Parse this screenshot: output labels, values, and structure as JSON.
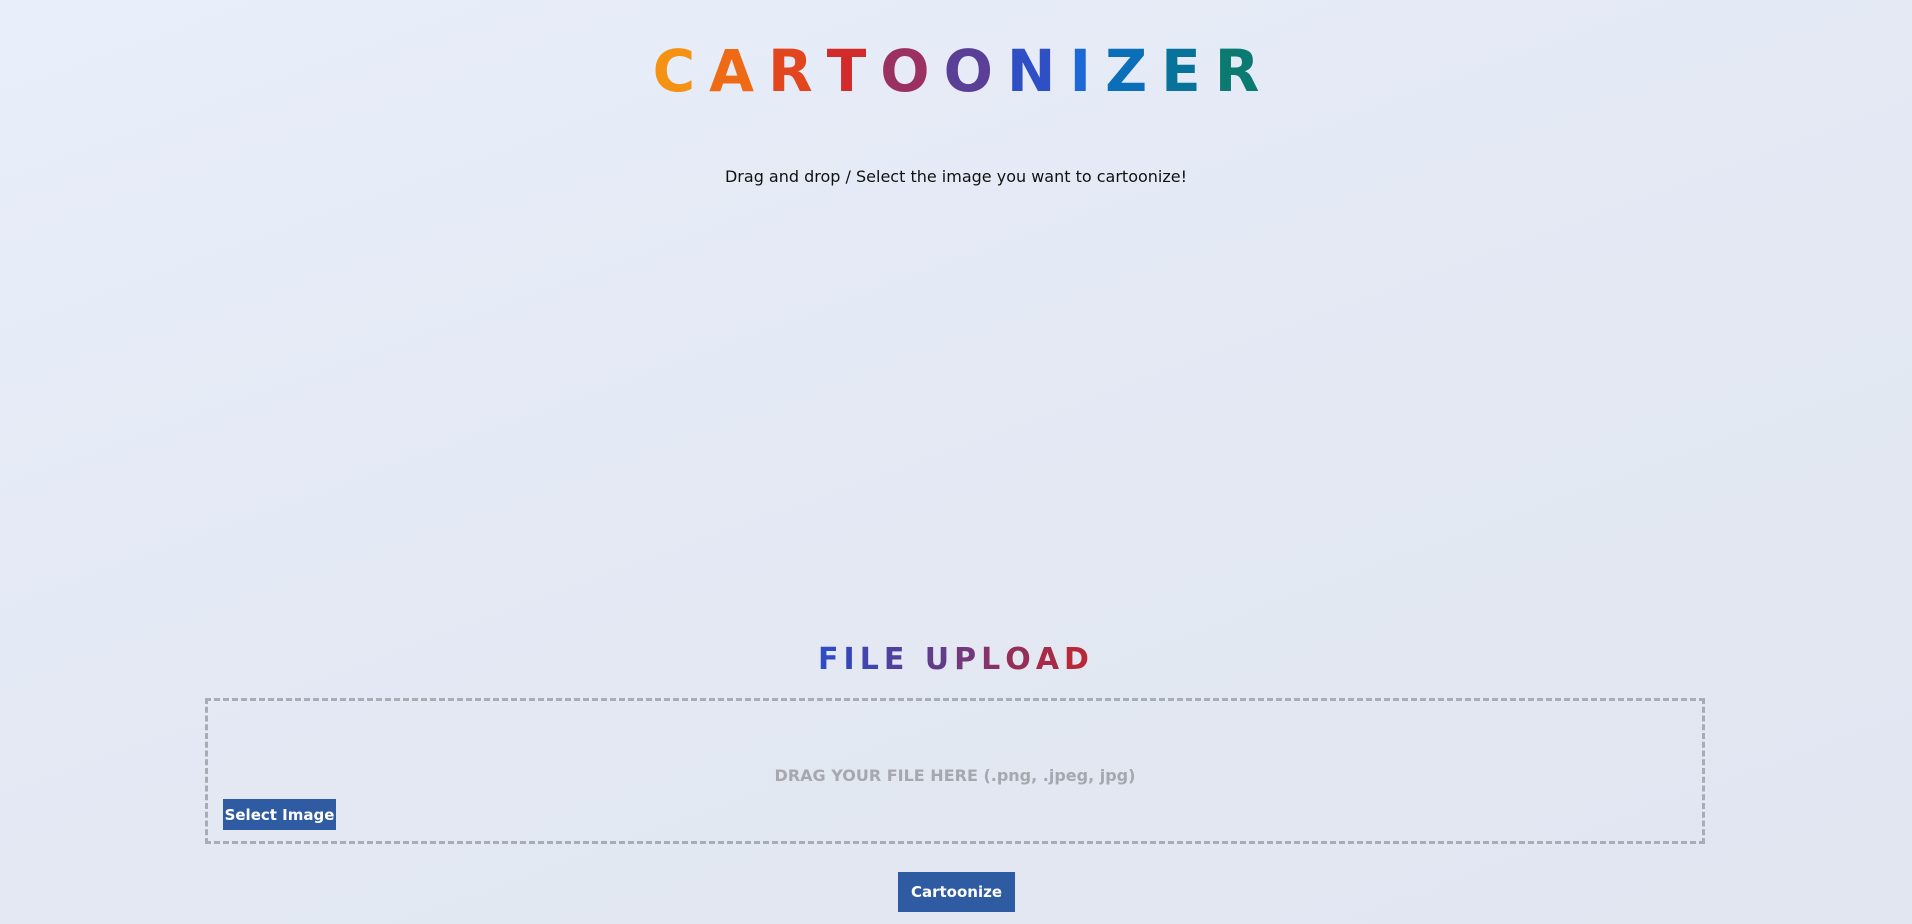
{
  "header": {
    "letters": [
      {
        "char": "C",
        "color": "#f59213"
      },
      {
        "char": "A",
        "color": "#ef6a14"
      },
      {
        "char": "R",
        "color": "#e2461e"
      },
      {
        "char": "T",
        "color": "#d12b2b"
      },
      {
        "char": "O",
        "color": "#9b3160"
      },
      {
        "char": "O",
        "color": "#5a3f97"
      },
      {
        "char": "N",
        "color": "#2f4fc4"
      },
      {
        "char": "I",
        "color": "#1c68d6"
      },
      {
        "char": "Z",
        "color": "#0a6eb8"
      },
      {
        "char": "E",
        "color": "#07729a"
      },
      {
        "char": "R",
        "color": "#0b7a70"
      }
    ]
  },
  "subtitle": "Drag and drop / Select the image you want to cartoonize!",
  "upload": {
    "heading_letters": [
      {
        "char": "F",
        "color": "#2f4cc2"
      },
      {
        "char": "I",
        "color": "#3648b8"
      },
      {
        "char": "L",
        "color": "#4245ab"
      },
      {
        "char": "E",
        "color": "#50419e"
      },
      {
        "char": " ",
        "color": "#50419e"
      },
      {
        "char": "U",
        "color": "#623d8c"
      },
      {
        "char": "P",
        "color": "#74397a"
      },
      {
        "char": "L",
        "color": "#853469"
      },
      {
        "char": "O",
        "color": "#962f57"
      },
      {
        "char": "A",
        "color": "#a72b47"
      },
      {
        "char": "D",
        "color": "#b82838"
      }
    ],
    "drop_hint": "DRAG YOUR FILE HERE (.png, .jpeg, jpg)",
    "select_label": "Select Image"
  },
  "actions": {
    "cartoonize_label": "Cartoonize"
  },
  "colors": {
    "button_bg": "#2f5ba3",
    "border_dashed": "#a9acb3"
  }
}
